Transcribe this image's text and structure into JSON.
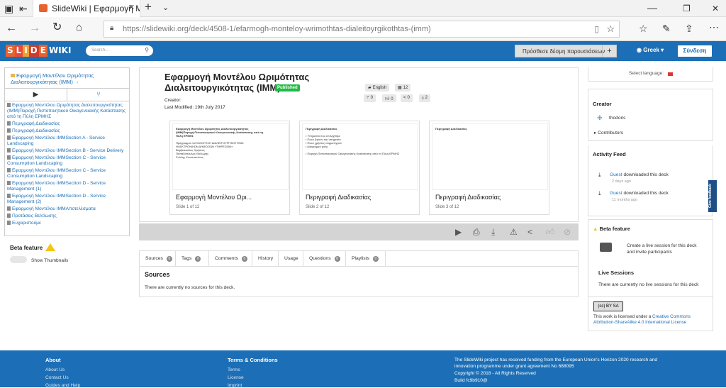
{
  "browser": {
    "tab_title": "SlideWiki | Εφαρμογή Μ",
    "url_prefix": "https://slidewiki.org",
    "url_path": "/deck/4508-1/efarmogh-monteloy-wrimothtas-dialeitoyrgikothtas-(imm)"
  },
  "header": {
    "logo_letters": [
      "S",
      "L",
      "I",
      "D",
      "E",
      "WIKI"
    ],
    "search_placeholder": "Search...",
    "add_session_label": "Πρόσθεσε δέσμη παρουσιάσεων",
    "language": "Greek",
    "login_label": "Σύνδεση"
  },
  "left": {
    "deck_title": "Εφαρμογή Μοντέλου Ωριμότητας Διαλειτουργικότητας (ΙΜΜ)",
    "slides": [
      "Εφαρμογή Μοντέλου Ωριμότητας Διαλειτουργικότητας (ΙΜΜ)Παροχή Πιστοποιητικού Οικογενειακής Κατάστασης από τη Πύλη ΕΡΜΗΣ",
      "Περιγραφή Διαδικασίας",
      "Περιγραφή Διαδικασίας",
      "Εφαρμογή Μοντέλου IMMSection A - Service Landscaping",
      "Εφαρμογή Μοντέλου IMMSection B - Service Delivery",
      "Εφαρμογή Μοντέλου IMMSection C - Service Consumption Landscaping",
      "Εφαρμογή Μοντέλου IMMSection C - Service Consumption Landscaping",
      "Εφαρμογή Μοντέλου IMMSection D - Service Management (1)",
      "Εφαρμογή Μοντέλου IMMSection D - Service Management (2)",
      "Εφαρμογή Μοντέλου IMMΑποτελέσματα",
      "Προτάσεις Βελτίωσης",
      "Ευχαριστούμε"
    ],
    "beta_label": "Beta feature",
    "thumbnails_label": "Show Thumbnails"
  },
  "deck": {
    "title": "Εφαρμογή Μοντέλου Ωριμότητας Διαλειτουργικότητας (ΙΜΜ)",
    "status": "Published",
    "creator_label": "Creator:",
    "last_modified": "Last Modified: 19th July 2017",
    "language_chip": "English",
    "slides_count": "12",
    "forks": "0",
    "likes": "0",
    "shares": "0",
    "downloads": "2"
  },
  "cards": [
    {
      "title": "Εφαρμογή Μοντέλου Ωρι...",
      "sub": "Slide 1 of 12",
      "preview": [
        "Εφαρμογή Μοντέλου Ωριμότητας Διαλειτουργικότητας",
        "(ΙΜΜ)Παροχή Πιστοποιητικού Οικογενειακής Κατάστασης από τη",
        "Πύλη ΕΡΜΗΣ",
        "",
        "Πρόγραμμα «ΑΞΙΟΛΟΓΗΣΗ ΔΙΑΛΕΙΤΟΥΡΓΙΚΟΤΗΤΑΣ",
        "ΗΛΕΚΤΡΟΝΙΚΩΝ ΔΗΜΟΣΙΩΝ ΥΠΗΡΕΣΙΩΝ»",
        "Βαρβακούλας Χρήστος",
        "Παπαδόπουλος Θοδωρής",
        "Σούλης Κωνσταντίνος"
      ]
    },
    {
      "title": "Περιγραφή Διαδικασίας",
      "sub": "Slide 2 of 12",
      "preview": [
        "Περιγραφή Διαδικασίας",
        "",
        "• Υπηρεσία που επιλέχθηκε",
        "• Ποιοι ζητούν την υπηρεσία",
        "• Ποιοι χρήστες συμμετέχουν",
        "• Διάγραμμα ροής",
        "",
        "• Παροχή Πιστοποιητικού Οικογενειακής Κατάστασης από τη Πύλη ΕΡΜΗΣ"
      ]
    },
    {
      "title": "Περιγραφή Διαδικασίας",
      "sub": "Slide 3 of 12",
      "preview": [
        "Περιγραφή Διαδικασίας",
        "."
      ]
    }
  ],
  "tabs": [
    {
      "label": "Sources",
      "count": "0"
    },
    {
      "label": "Tags",
      "count": "0"
    },
    {
      "label": "Comments",
      "count": "0"
    },
    {
      "label": "History",
      "count": ""
    },
    {
      "label": "Usage",
      "count": ""
    },
    {
      "label": "Questions",
      "count": "0"
    },
    {
      "label": "Playlists",
      "count": "0"
    }
  ],
  "sources": {
    "heading": "Sources",
    "empty": "There are currently no sources for this deck."
  },
  "right": {
    "select_language": "Select language:",
    "creator_heading": "Creator",
    "creator_name": "thodoris",
    "contributors": "Contributors",
    "activity_heading": "Activity Feed",
    "activities": [
      {
        "user": "Guest",
        "text": "downloaded this deck",
        "time": "2 days ago"
      },
      {
        "user": "Guest",
        "text": "downloaded this deck",
        "time": "11 months ago"
      }
    ],
    "beta_label": "Beta feature",
    "live_text": "Create a live session for this deck and invite participants",
    "live_heading": "Live Sessions",
    "live_none": "There are currently no live sessions for this deck",
    "license_prefix": "This work is licensed under a",
    "license_link": "Creative Commons Attribution-ShareAlike 4.0 International License",
    "feedback": "Give feedback"
  },
  "footer": {
    "about_heading": "About",
    "about_links": [
      "About Us",
      "Contact Us",
      "Guides and Help"
    ],
    "terms_heading": "Terms & Conditions",
    "terms_links": [
      "Terms",
      "License",
      "Imprint"
    ],
    "funding": "The SlideWiki project has received funding from the European Union's Horizon 2020 research and innovation programme under grant agreement No 688095",
    "copyright": "Copyright © 2018 - All Rights Reserved",
    "build": "Build fc9b910@"
  }
}
